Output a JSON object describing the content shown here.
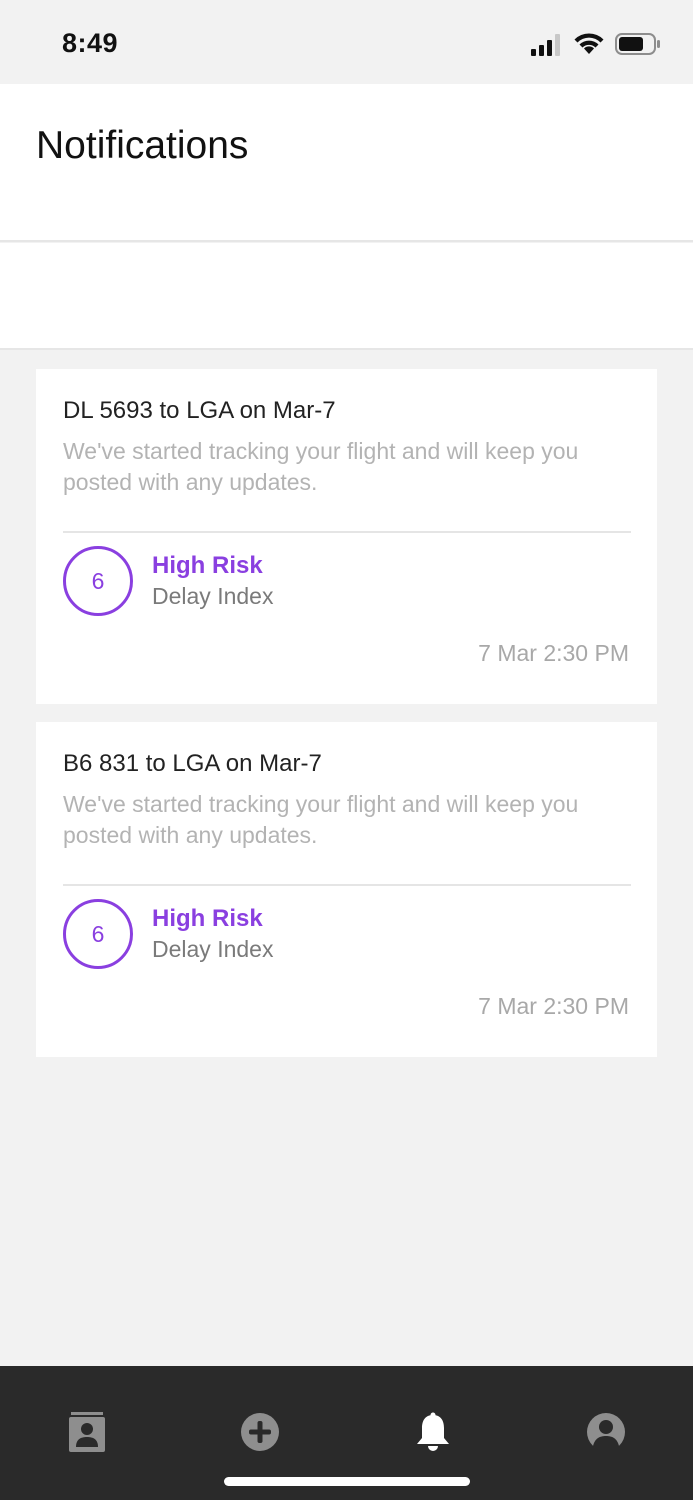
{
  "status_bar": {
    "time": "8:49",
    "icons": [
      "cellular-signal-icon",
      "wifi-icon",
      "battery-icon"
    ]
  },
  "header": {
    "title": "Notifications"
  },
  "notifications": [
    {
      "title": "DL 5693 to LGA on Mar-7",
      "message": "We've started tracking your flight and will keep you posted with any updates.",
      "delay_index": "6",
      "risk_level": "High Risk",
      "risk_label": "Delay Index",
      "timestamp": "7 Mar 2:30 PM"
    },
    {
      "title": "B6 831 to LGA on Mar-7",
      "message": "We've started tracking your flight and will keep you posted with any updates.",
      "delay_index": "6",
      "risk_level": "High Risk",
      "risk_label": "Delay Index",
      "timestamp": "7 Mar 2:30 PM"
    }
  ],
  "tab_bar": {
    "items": [
      {
        "icon": "contact-card-icon",
        "active": false
      },
      {
        "icon": "add-circle-icon",
        "active": false
      },
      {
        "icon": "bell-icon",
        "active": true
      },
      {
        "icon": "profile-icon",
        "active": false
      }
    ]
  },
  "colors": {
    "accent": "#8a3fe0",
    "background": "#f2f2f2",
    "card": "#ffffff",
    "tab_bar": "#2a2a2a",
    "tab_inactive": "#8e8e8e",
    "tab_active": "#ffffff"
  }
}
